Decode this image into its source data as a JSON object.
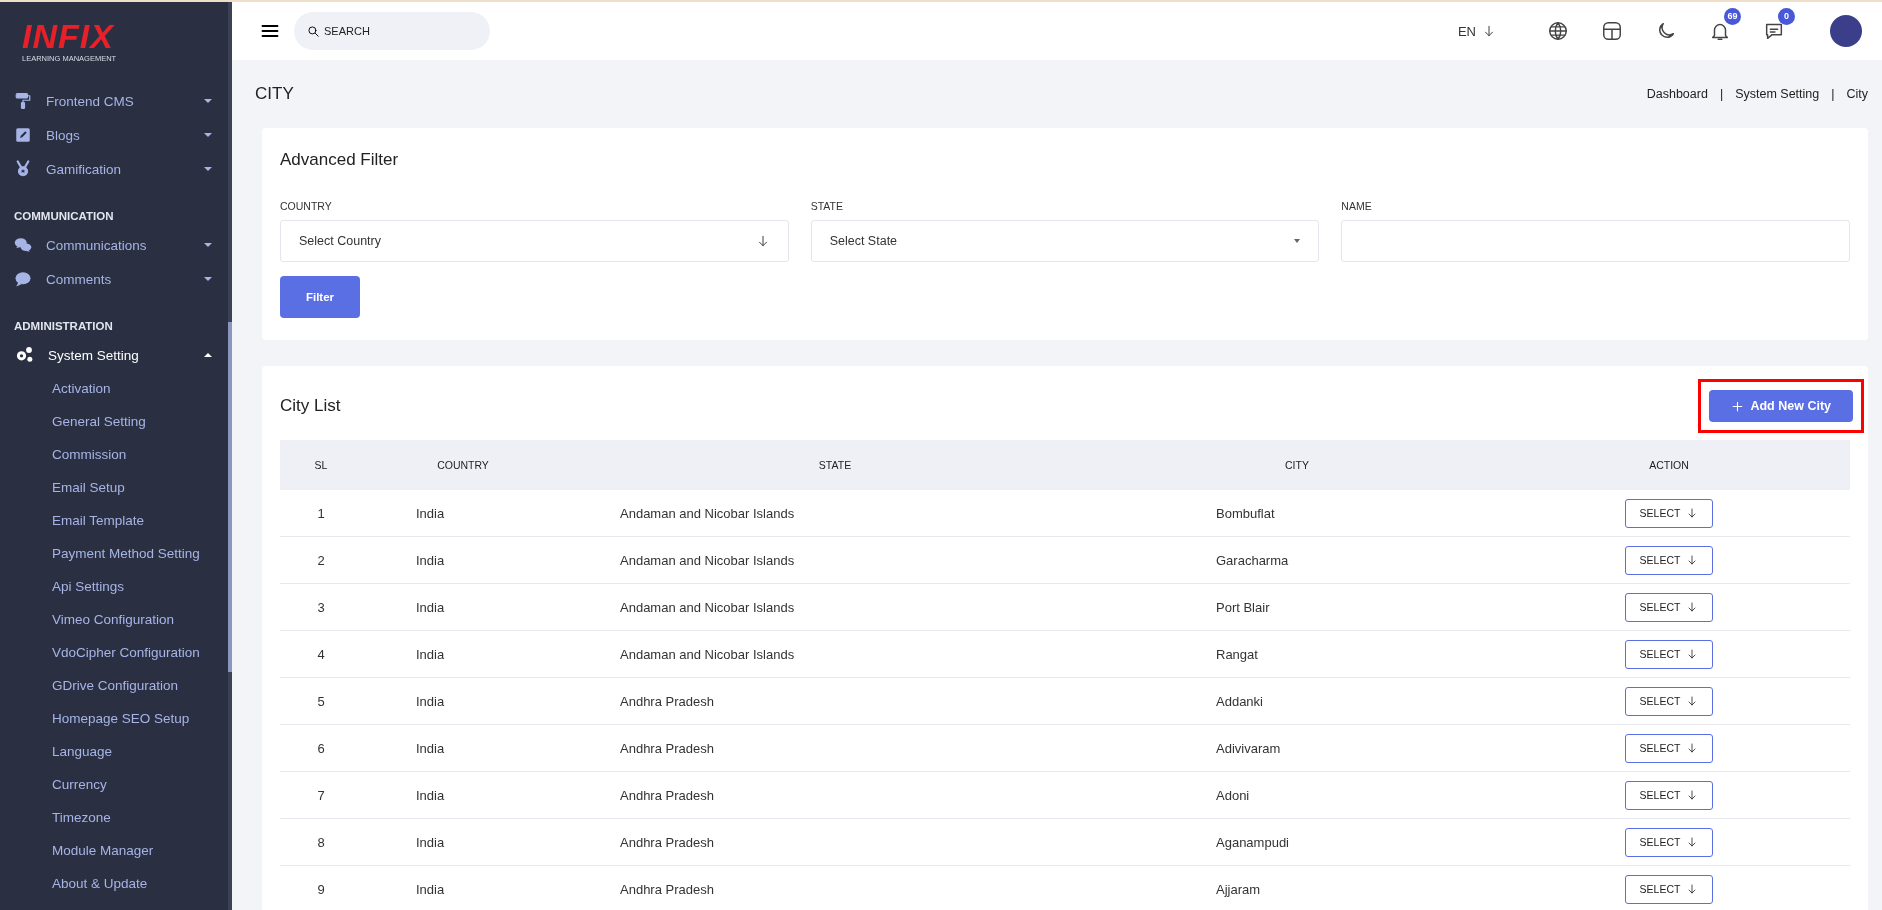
{
  "sidebar": {
    "logo": {
      "title": "INFIX",
      "subtitle": "LEARNING MANAGEMENT"
    },
    "groups": [
      {
        "items": [
          {
            "label": "Frontend CMS",
            "expanded": false
          },
          {
            "label": "Blogs",
            "expanded": false
          },
          {
            "label": "Gamification",
            "expanded": false
          }
        ]
      },
      {
        "heading": "COMMUNICATION",
        "items": [
          {
            "label": "Communications",
            "expanded": false
          },
          {
            "label": "Comments",
            "expanded": false
          }
        ]
      },
      {
        "heading": "ADMINISTRATION",
        "items": [
          {
            "label": "System Setting",
            "expanded": true,
            "children": [
              "Activation",
              "General Setting",
              "Commission",
              "Email Setup",
              "Email Template",
              "Payment Method Setting",
              "Api Settings",
              "Vimeo Configuration",
              "VdoCipher Configuration",
              "GDrive Configuration",
              "Homepage SEO Setup",
              "Language",
              "Currency",
              "Timezone",
              "Module Manager",
              "About & Update"
            ]
          }
        ]
      }
    ]
  },
  "header": {
    "search": {
      "placeholder": "SEARCH"
    },
    "language": "EN",
    "notifications": "69",
    "messages": "0"
  },
  "page": {
    "title": "CITY",
    "breadcrumbs": [
      "Dashboard",
      "System Setting",
      "City"
    ],
    "breadcrumb_separator": "|"
  },
  "filter": {
    "title": "Advanced Filter",
    "fields": [
      {
        "label": "COUNTRY",
        "kind": "arrow-select",
        "value": "Select Country"
      },
      {
        "label": "STATE",
        "kind": "triangle-select",
        "value": "Select State"
      },
      {
        "label": "NAME",
        "kind": "text"
      }
    ],
    "button": "Filter"
  },
  "city_list": {
    "title": "City List",
    "add_button": {
      "label": "Add New City",
      "highlighted": true
    },
    "columns": [
      "SL",
      "COUNTRY",
      "STATE",
      "CITY",
      "ACTION"
    ],
    "rows": [
      {
        "sl": "1",
        "country": "India",
        "state": "Andaman and Nicobar Islands",
        "city": "Bombuflat",
        "action": "SELECT"
      },
      {
        "sl": "2",
        "country": "India",
        "state": "Andaman and Nicobar Islands",
        "city": "Garacharma",
        "action": "SELECT"
      },
      {
        "sl": "3",
        "country": "India",
        "state": "Andaman and Nicobar Islands",
        "city": "Port Blair",
        "action": "SELECT"
      },
      {
        "sl": "4",
        "country": "India",
        "state": "Andaman and Nicobar Islands",
        "city": "Rangat",
        "action": "SELECT"
      },
      {
        "sl": "5",
        "country": "India",
        "state": "Andhra Pradesh",
        "city": "Addanki",
        "action": "SELECT"
      },
      {
        "sl": "6",
        "country": "India",
        "state": "Andhra Pradesh",
        "city": "Adivivaram",
        "action": "SELECT"
      },
      {
        "sl": "7",
        "country": "India",
        "state": "Andhra Pradesh",
        "city": "Adoni",
        "action": "SELECT"
      },
      {
        "sl": "8",
        "country": "India",
        "state": "Andhra Pradesh",
        "city": "Aganampudi",
        "action": "SELECT"
      },
      {
        "sl": "9",
        "country": "India",
        "state": "Andhra Pradesh",
        "city": "Ajjaram",
        "action": "SELECT"
      }
    ]
  }
}
